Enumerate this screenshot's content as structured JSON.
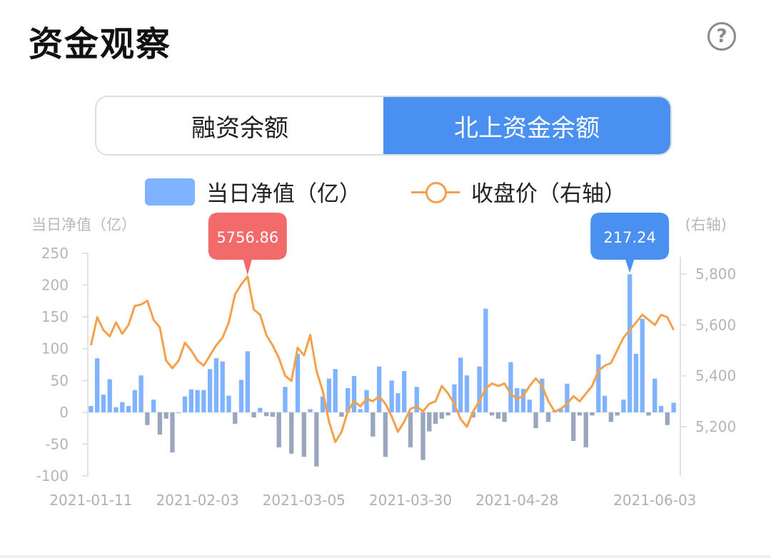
{
  "header": {
    "title": "资金观察",
    "help_icon": "question-circle-icon",
    "help_symbol": "?"
  },
  "tabs": [
    {
      "label": "融资余额",
      "active": false
    },
    {
      "label": "北上资金余额",
      "active": true
    }
  ],
  "legend": {
    "bar_label": "当日净值（亿）",
    "line_label": "收盘价（右轴）"
  },
  "colors": {
    "positive_bar": "#80b3ff",
    "negative_bar": "#9aa6bd",
    "line": "#f5a04a",
    "callout_red": "#f26a6a",
    "callout_blue": "#4a90f0",
    "accent": "#4a90f0"
  },
  "chart_data": {
    "type": "bar",
    "left_axis_label": "当日净值（亿）",
    "right_axis_label": "(右轴)",
    "ylim_left": [
      -100,
      250
    ],
    "yticks_left": [
      250,
      200,
      150,
      100,
      50,
      0,
      -50,
      -100
    ],
    "ylim_right": [
      5100,
      5880
    ],
    "yticks_right": [
      "5,800",
      "5,600",
      "5,400",
      "5,200"
    ],
    "yticks_right_values": [
      5800,
      5600,
      5400,
      5200
    ],
    "x_tick_labels": [
      "2021-01-11",
      "2021-02-03",
      "2021-03-05",
      "2021-03-30",
      "2021-04-28",
      "2021-06-03"
    ],
    "x_tick_indices": [
      0,
      17,
      34,
      51,
      68,
      90
    ],
    "series": [
      {
        "name": "当日净值（亿）",
        "type": "bar",
        "values": [
          10,
          85,
          28,
          52,
          8,
          16,
          10,
          35,
          58,
          -20,
          20,
          -35,
          -10,
          -63,
          0,
          25,
          36,
          35,
          35,
          68,
          85,
          80,
          26,
          -18,
          51,
          96,
          -8,
          7,
          -6,
          -7,
          -55,
          40,
          -65,
          92,
          -70,
          5,
          -85,
          25,
          53,
          68,
          -7,
          38,
          57,
          5,
          35,
          -38,
          72,
          -70,
          50,
          30,
          65,
          -55,
          40,
          -75,
          -30,
          -18,
          -10,
          -5,
          44,
          86,
          58,
          -8,
          72,
          163,
          -5,
          -10,
          -15,
          79,
          38,
          37,
          20,
          -25,
          53,
          -15,
          3,
          5,
          45,
          -45,
          -5,
          -55,
          -5,
          91,
          26,
          -15,
          -5,
          20,
          217,
          92,
          147,
          -5,
          53,
          10,
          -20,
          15
        ]
      },
      {
        "name": "收盘价（右轴）",
        "type": "line",
        "values": [
          5520,
          5630,
          5580,
          5555,
          5610,
          5565,
          5600,
          5675,
          5680,
          5695,
          5620,
          5590,
          5460,
          5430,
          5460,
          5530,
          5500,
          5460,
          5440,
          5480,
          5520,
          5550,
          5610,
          5720,
          5760,
          5790,
          5660,
          5640,
          5560,
          5520,
          5470,
          5400,
          5380,
          5510,
          5480,
          5560,
          5420,
          5340,
          5220,
          5140,
          5180,
          5260,
          5300,
          5280,
          5310,
          5300,
          5320,
          5290,
          5240,
          5180,
          5220,
          5270,
          5280,
          5260,
          5290,
          5300,
          5360,
          5330,
          5290,
          5230,
          5200,
          5260,
          5300,
          5350,
          5370,
          5360,
          5370,
          5330,
          5310,
          5320,
          5360,
          5390,
          5360,
          5300,
          5260,
          5270,
          5290,
          5320,
          5300,
          5330,
          5360,
          5420,
          5440,
          5450,
          5500,
          5550,
          5580,
          5610,
          5640,
          5620,
          5600,
          5640,
          5630,
          5580
        ]
      }
    ],
    "annotations": [
      {
        "label": "5756.86",
        "series": "收盘价（右轴）",
        "index": 25,
        "color": "red"
      },
      {
        "label": "217.24",
        "series": "当日净值（亿）",
        "index": 86,
        "color": "blue"
      }
    ]
  }
}
